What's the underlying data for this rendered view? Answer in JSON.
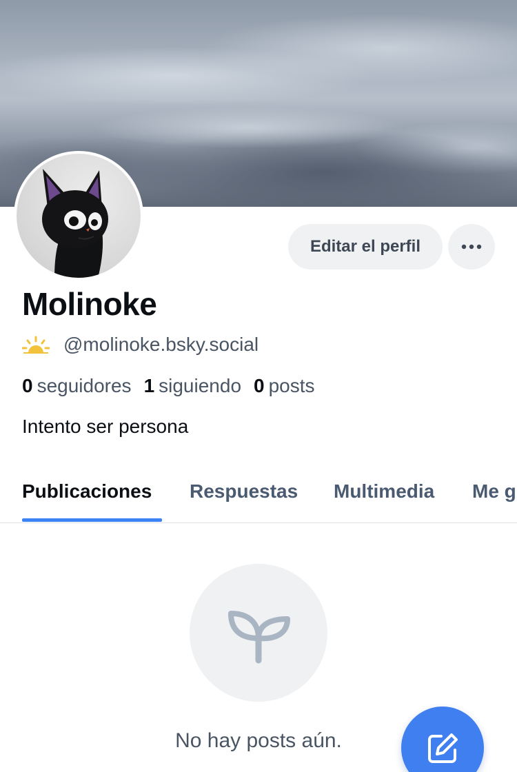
{
  "profile": {
    "display_name": "Molinoke",
    "handle": "@molinoke.bsky.social",
    "bio": "Intento ser persona",
    "stats": {
      "followers_count": "0",
      "followers_label": "seguidores",
      "following_count": "1",
      "following_label": "siguiendo",
      "posts_count": "0",
      "posts_label": "posts"
    }
  },
  "actions": {
    "edit_label": "Editar el perfil",
    "more_icon": "ellipsis-icon"
  },
  "tabs": [
    {
      "label": "Publicaciones",
      "active": true
    },
    {
      "label": "Respuestas",
      "active": false
    },
    {
      "label": "Multimedia",
      "active": false
    },
    {
      "label": "Me g",
      "active": false
    }
  ],
  "empty_state": {
    "icon": "seedling-icon",
    "text": "No hay posts aún."
  },
  "fab": {
    "icon": "compose-icon"
  },
  "colors": {
    "accent": "#3b82f6",
    "fab": "#3f7ff0",
    "button_bg": "#eff1f3",
    "muted_text": "#4a5564"
  }
}
